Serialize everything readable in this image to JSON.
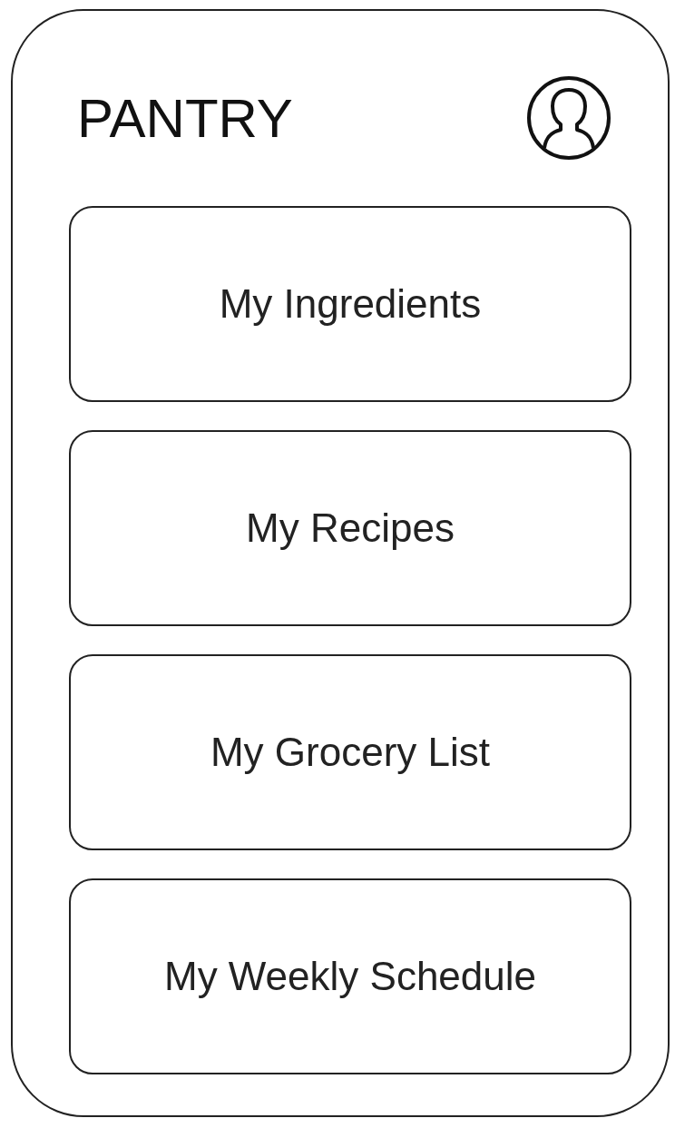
{
  "header": {
    "title": "PANTRY"
  },
  "menu": [
    {
      "label": "My Ingredients"
    },
    {
      "label": "My Recipes"
    },
    {
      "label": "My Grocery List"
    },
    {
      "label": "My Weekly Schedule"
    }
  ]
}
